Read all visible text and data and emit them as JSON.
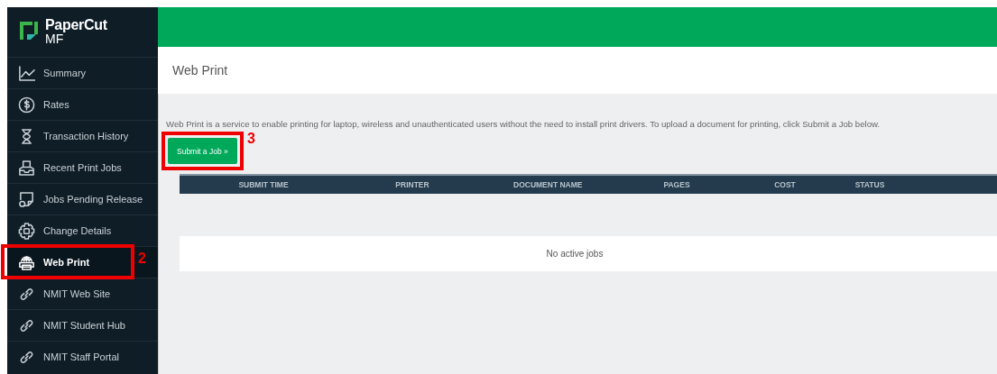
{
  "logo": {
    "name": "PaperCut",
    "edition": "MF"
  },
  "sidebar": {
    "items": [
      {
        "label": "Summary",
        "kind": "chart",
        "selected": false
      },
      {
        "label": "Rates",
        "kind": "dollar",
        "selected": false
      },
      {
        "label": "Transaction History",
        "kind": "hourglass",
        "selected": false
      },
      {
        "label": "Recent Print Jobs",
        "kind": "tray",
        "selected": false
      },
      {
        "label": "Jobs Pending Release",
        "kind": "pending",
        "selected": false
      },
      {
        "label": "Change Details",
        "kind": "gear",
        "selected": false
      },
      {
        "label": "Web Print",
        "kind": "webprint",
        "selected": true
      },
      {
        "label": "NMIT Web Site",
        "kind": "link",
        "selected": false
      },
      {
        "label": "NMIT Student Hub",
        "kind": "link",
        "selected": false
      },
      {
        "label": "NMIT Staff Portal",
        "kind": "link",
        "selected": false
      }
    ]
  },
  "page_title": "Web Print",
  "description": "Web Print is a service to enable printing for laptop, wireless and unauthenticated users without the need to install print drivers. To upload a document for printing, click Submit a Job below.",
  "submit_button": "Submit a Job »",
  "table": {
    "columns": [
      "SUBMIT TIME",
      "PRINTER",
      "DOCUMENT NAME",
      "PAGES",
      "COST",
      "STATUS"
    ],
    "empty_message": "No active jobs"
  },
  "annotations": [
    {
      "number": "2",
      "kind": "sidebar"
    },
    {
      "number": "3",
      "kind": "button"
    }
  ]
}
